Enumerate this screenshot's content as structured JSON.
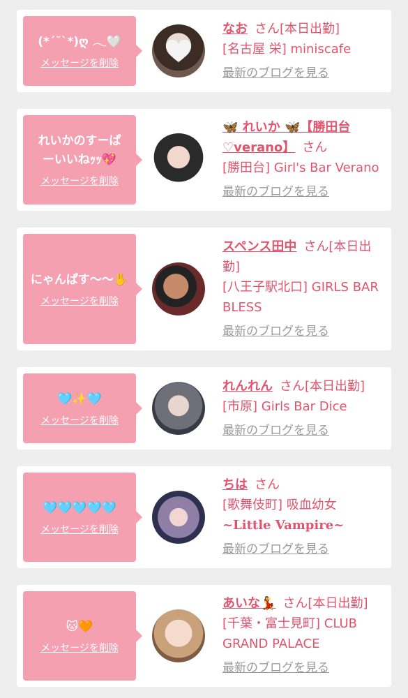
{
  "cards": [
    {
      "message": "(*´˘`*)ღ 𓂃🤍",
      "delete_label": "メッセージを削除",
      "name": "なお",
      "san": "さん",
      "status": "[本日出勤]",
      "shop": "[名古屋 栄] miniscafe",
      "blog_label": "最新のブログを見る"
    },
    {
      "message": "れいかのすーぱーいいねｯｯ💖",
      "delete_label": "メッセージを削除",
      "name": "🦋 れいか 🦋【勝田台♡verano】",
      "san": "さん",
      "status": "",
      "shop": "[勝田台] Girl's Bar Verano",
      "blog_label": "最新のブログを見る"
    },
    {
      "message": "にゃんぱす〜〜✋",
      "delete_label": "メッセージを削除",
      "name": "スペンス田中",
      "san": "さん",
      "status": "[本日出勤]",
      "shop": "[八王子駅北口] GIRLS BAR BLESS",
      "blog_label": "最新のブログを見る"
    },
    {
      "message": "🩵✨🩵",
      "delete_label": "メッセージを削除",
      "name": "れんれん",
      "san": "さん",
      "status": "[本日出勤]",
      "shop": "[市原] Girls Bar Dice",
      "blog_label": "最新のブログを見る"
    },
    {
      "message": "🩵🩵🩵🩵🩵",
      "delete_label": "メッセージを削除",
      "name": "ちは",
      "san": "さん",
      "status": "",
      "shop_prefix": "[歌舞伎町] 吸血幼女",
      "shop_suffix": "~Little Vampire~",
      "blog_label": "最新のブログを見る"
    },
    {
      "message": "🐱🧡",
      "delete_label": "メッセージを削除",
      "name": "あいな💃",
      "san": "さん",
      "status": "[本日出勤]",
      "shop": "[千葉・富士見町] CLUB GRAND PALACE",
      "blog_label": "最新のブログを見る"
    }
  ]
}
